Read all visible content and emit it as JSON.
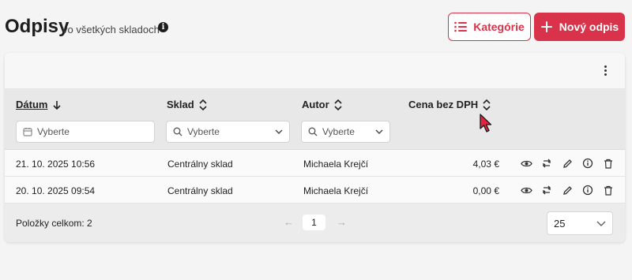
{
  "header": {
    "title": "Odpisy",
    "subtitle": "vo všetkých skladoch",
    "info_icon": "info-icon",
    "categories_label": "Kategórie",
    "new_label": "Nový odpis"
  },
  "table": {
    "columns": {
      "date": "Dátum",
      "sklad": "Sklad",
      "autor": "Autor",
      "cena": "Cena bez DPH"
    },
    "filters": {
      "date_placeholder": "Vyberte",
      "sklad_placeholder": "Vyberte",
      "autor_placeholder": "Vyberte"
    },
    "rows": [
      {
        "date": "21. 10. 2025 10:56",
        "sklad": "Centrálny sklad",
        "autor": "Michaela Krejčí",
        "cena": "4,03 €"
      },
      {
        "date": "20. 10. 2025 09:54",
        "sklad": "Centrálny sklad",
        "autor": "Michaela Krejčí",
        "cena": "0,00 €"
      }
    ],
    "row_actions": [
      "eye-icon",
      "transfer-icon",
      "pencil-icon",
      "info-icon",
      "trash-icon"
    ]
  },
  "footer": {
    "total_label": "Položky celkom: 2",
    "current_page": "1",
    "per_page": "25"
  },
  "colors": {
    "accent": "#d8334a",
    "background": "#f4f4f4",
    "header_row": "#e8e8e8",
    "cursor": "#e0253f"
  }
}
